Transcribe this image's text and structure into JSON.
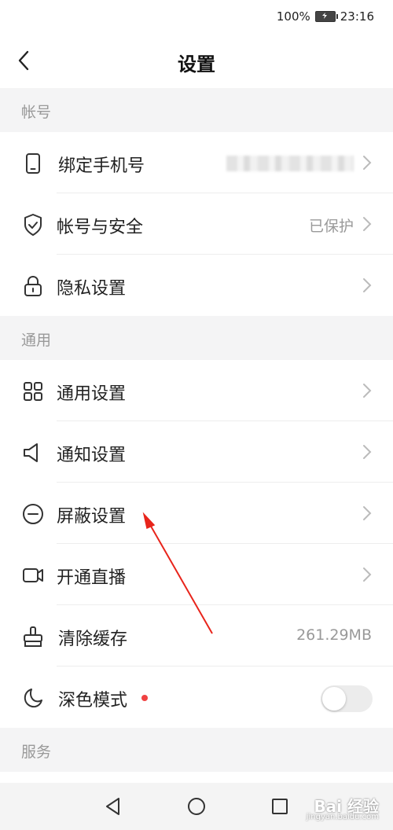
{
  "status_bar": {
    "battery": "100%",
    "time": "23:16"
  },
  "header": {
    "title": "设置",
    "back_icon": "chevron-left-icon"
  },
  "sections": {
    "account": "帐号",
    "general": "通用",
    "service": "服务"
  },
  "rows": {
    "bind_phone": {
      "label": "绑定手机号",
      "icon": "phone-icon"
    },
    "account_security": {
      "label": "帐号与安全",
      "value": "已保护",
      "icon": "shield-check-icon"
    },
    "privacy": {
      "label": "隐私设置",
      "icon": "lock-icon"
    },
    "general_settings": {
      "label": "通用设置",
      "icon": "grid-icon"
    },
    "notification": {
      "label": "通知设置",
      "icon": "speaker-icon"
    },
    "block": {
      "label": "屏蔽设置",
      "icon": "minus-circle-icon"
    },
    "live": {
      "label": "开通直播",
      "icon": "video-camera-icon"
    },
    "clear_cache": {
      "label": "清除缓存",
      "value": "261.29MB",
      "icon": "broom-icon"
    },
    "dark_mode": {
      "label": "深色模式",
      "icon": "moon-icon",
      "enabled": false
    }
  },
  "watermark": {
    "text": "Bai 经验",
    "sub": "jingyan.baidu.com"
  },
  "colors": {
    "annotation_arrow": "#e8241b",
    "red_dot": "#f04242"
  }
}
